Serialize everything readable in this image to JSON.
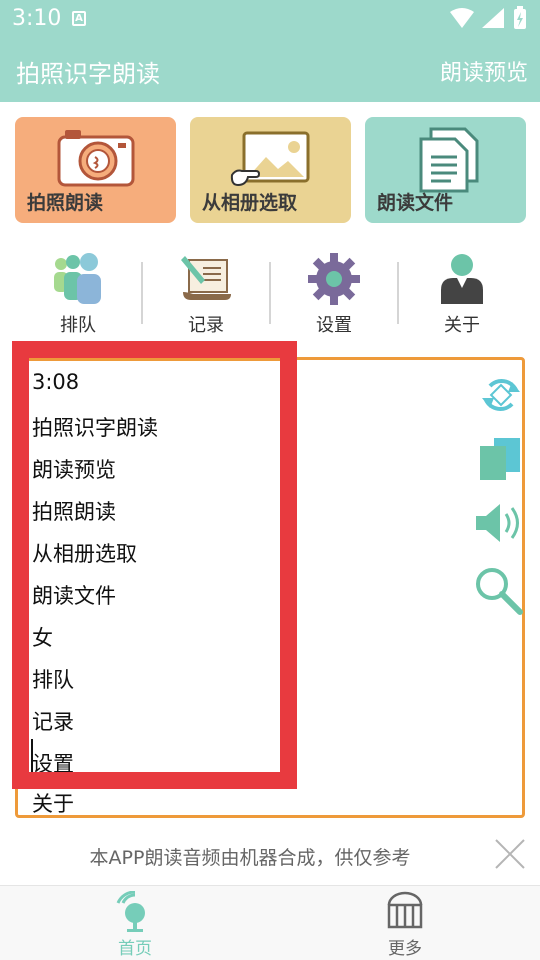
{
  "status_bar": {
    "time": "3:10",
    "notification_icon_text": "A",
    "icons": [
      "wifi-icon",
      "signal-icon",
      "battery-icon"
    ]
  },
  "header": {
    "title": "拍照识字朗读",
    "action": "朗读预览"
  },
  "tiles": [
    {
      "label": "拍照朗读",
      "icon": "camera-icon",
      "color": "#f6ad7c"
    },
    {
      "label": "从相册选取",
      "icon": "gallery-icon",
      "color": "#ead393"
    },
    {
      "label": "朗读文件",
      "icon": "document-icon",
      "color": "#9dd9cb"
    }
  ],
  "quick_actions": [
    {
      "label": "排队",
      "icon": "queue-icon"
    },
    {
      "label": "记录",
      "icon": "record-icon"
    },
    {
      "label": "设置",
      "icon": "gear-icon"
    },
    {
      "label": "关于",
      "icon": "about-icon"
    }
  ],
  "text_panel": {
    "lines": [
      "3:08",
      "拍照识字朗读",
      "朗读预览",
      "拍照朗读",
      "从相册选取",
      "朗读文件",
      "女",
      "排队",
      "记录",
      "设置",
      "关于"
    ],
    "tools": [
      "rotate-icon",
      "copy-icon",
      "speaker-icon",
      "search-icon"
    ]
  },
  "disclaimer": "本APP朗读音频由机器合成，供仅参考",
  "bottom_nav": [
    {
      "label": "首页",
      "icon": "home-icon",
      "active": true
    },
    {
      "label": "更多",
      "icon": "more-icon",
      "active": false
    }
  ],
  "colors": {
    "primary": "#9dd9cb",
    "orange_border": "#ee9a3a",
    "annotation_red": "#e83a3f",
    "nav_active": "#76cdb9",
    "nav_inactive": "#666666"
  }
}
